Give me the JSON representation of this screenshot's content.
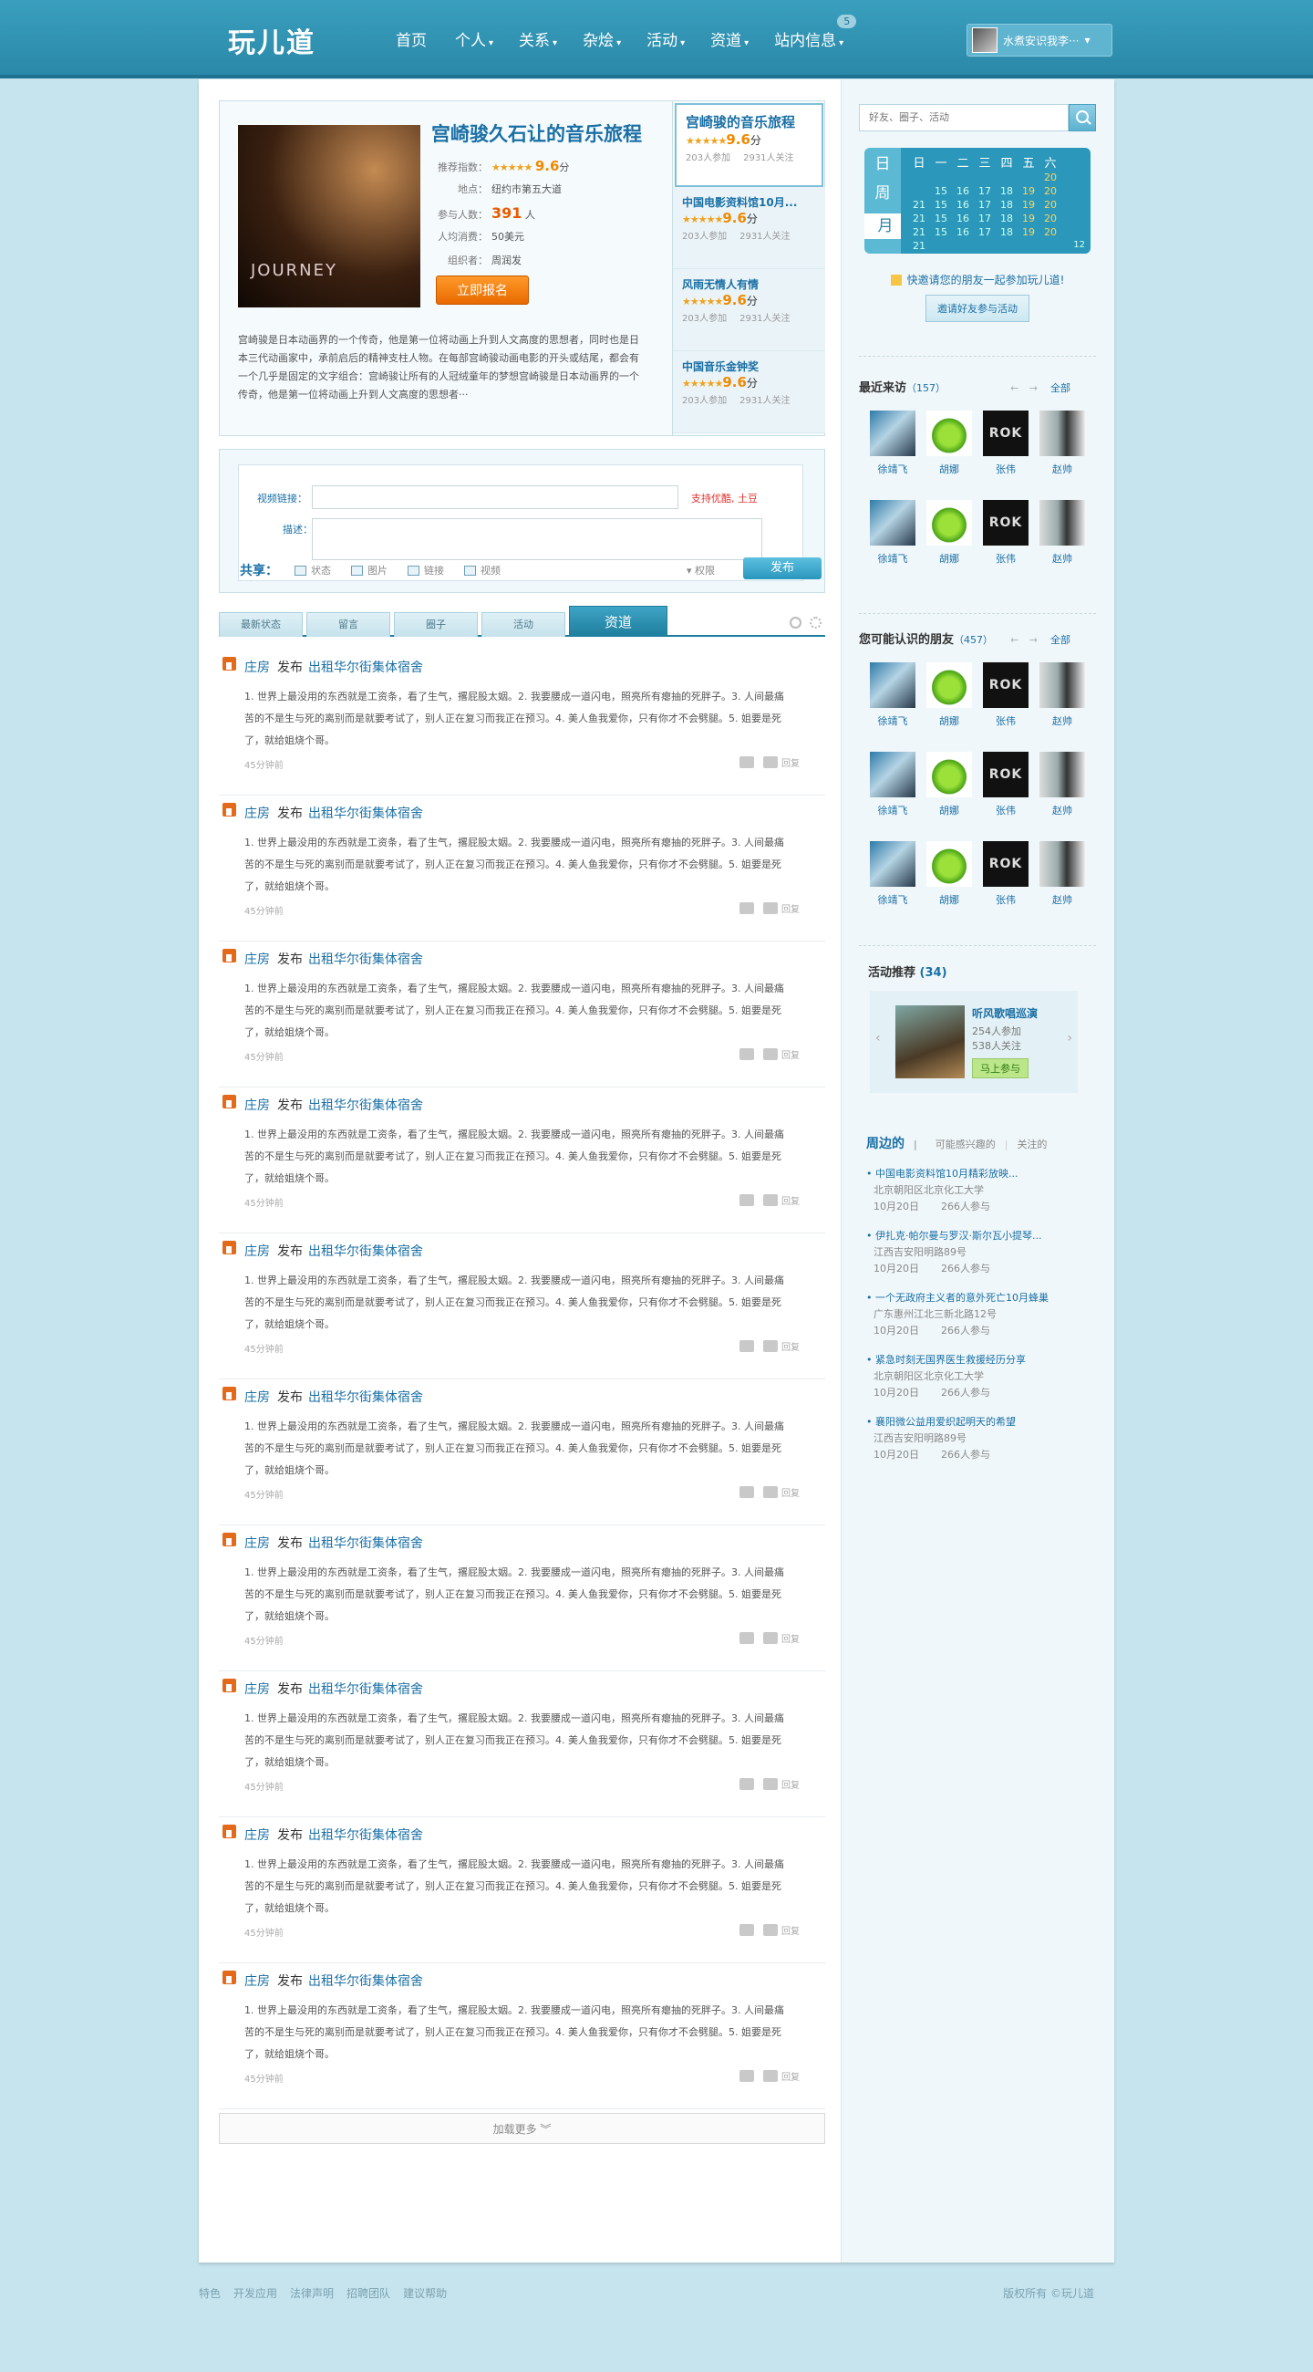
{
  "header": {
    "logo": "玩儿道",
    "nav": [
      {
        "label": "首页",
        "caret": ""
      },
      {
        "label": "个人",
        "caret": "▾"
      },
      {
        "label": "关系",
        "caret": "▾"
      },
      {
        "label": "杂烩",
        "caret": "▾"
      },
      {
        "label": "活动",
        "caret": "▾"
      },
      {
        "label": "资道",
        "caret": "▾"
      },
      {
        "label": "站内信息",
        "caret": "▾"
      }
    ],
    "message_badge": "5",
    "user_name": "水煮安识我李···",
    "user_caret": "▾"
  },
  "featured": {
    "title": "宫崎骏久石让的音乐旅程",
    "poster_text": "JOURNEY",
    "rows": [
      {
        "k": "推荐指数：",
        "stars": "★★★★★",
        "score": "9.6",
        "unit": "分"
      },
      {
        "k": "地点：",
        "v": "纽约市第五大道"
      },
      {
        "k": "参与人数：",
        "count": "391",
        "unit": "人"
      },
      {
        "k": "人均消费：",
        "v": "50美元"
      },
      {
        "k": "组织者：",
        "v": "周润发"
      }
    ],
    "signup": "立即报名",
    "desc": "宫崎骏是日本动画界的一个传奇，他是第一位将动画上升到人文高度的思想者，同时也是日本三代动画家中，承前启后的精神支柱人物。在每部宫崎骏动画电影的开头或结尾，都会有一个几乎是固定的文字组合：宫崎骏让所有的人冠绒童年的梦想宫崎骏是日本动画界的一个传奇，他是第一位将动画上升到人文高度的思想者···",
    "list": [
      {
        "title": "宫崎骏的音乐旅程",
        "stars": "★★★★★",
        "score": "9.6",
        "unit": "分",
        "join": "203人参加",
        "follow": "2931人关注"
      },
      {
        "title": "中国电影资料馆10月...",
        "stars": "★★★★★",
        "score": "9.6",
        "unit": "分",
        "join": "203人参加",
        "follow": "2931人关注"
      },
      {
        "title": "风雨无情人有情",
        "stars": "★★★★★",
        "score": "9.6",
        "unit": "分",
        "join": "203人参加",
        "follow": "2931人关注"
      },
      {
        "title": "中国音乐金钟奖",
        "stars": "★★★★★",
        "score": "9.6",
        "unit": "分",
        "join": "203人参加",
        "follow": "2931人关注"
      }
    ]
  },
  "share": {
    "video_label": "视频链接：",
    "desc_label": "描述：",
    "hint": "支持优酷, 土豆",
    "share_label": "共享：",
    "tools": [
      "状态",
      "图片",
      "链接",
      "视频"
    ],
    "permission": "▾ 权限",
    "post": "发布"
  },
  "tabs": [
    "最新状态",
    "留言",
    "圈子",
    "活动",
    "资道"
  ],
  "feed": {
    "user": "庄房",
    "verb": "发布",
    "topic": "出租华尔街集体宿舍",
    "text": "1. 世界上最没用的东西就是工资条，看了生气，撂屁股太姻。2. 我要腰成一道闪电，照亮所有瘪抽的死胖子。3. 人间最痛苦的不是生与死的离别而是就要考试了，别人正在复习而我正在预习。4. 美人鱼我爱你，只有你才不会劈腿。5. 姐要是死了，就给姐烧个哥。",
    "time": "45分钟前",
    "act": "回复",
    "count": 10
  },
  "load_more": "加载更多 ︾",
  "search": {
    "placeholder": "好友、圈子、活动"
  },
  "calendar": {
    "side": [
      "日",
      "周",
      "月"
    ],
    "head": [
      "日",
      "一",
      "二",
      "三",
      "四",
      "五",
      "六"
    ],
    "weeks": [
      [
        "",
        "",
        "",
        "",
        "",
        "",
        "20"
      ],
      [
        "",
        "15",
        "16",
        "17",
        "18",
        "19",
        "20"
      ],
      [
        "21",
        "15",
        "16",
        "17",
        "18",
        "19",
        "20"
      ],
      [
        "21",
        "15",
        "16",
        "17",
        "18",
        "19",
        "20"
      ],
      [
        "21",
        "15",
        "16",
        "17",
        "18",
        "19",
        "20"
      ],
      [
        "21",
        "",
        "",
        "",
        "",
        "",
        ""
      ]
    ],
    "page": "12"
  },
  "invite": {
    "text": "快邀请您的朋友一起参加玩儿道!",
    "button": "邀请好友参与活动"
  },
  "recent": {
    "title": "最近来访",
    "count": "（157）",
    "all": "全部",
    "arrows": "← →"
  },
  "maybe": {
    "title": "您可能认识的朋友",
    "count": "（457）",
    "all": "全部",
    "arrows": "← →"
  },
  "friends": [
    {
      "name": "徐靖飞",
      "ph": "p1"
    },
    {
      "name": "胡娜",
      "ph": "p2"
    },
    {
      "name": "张伟",
      "ph": "p3"
    },
    {
      "name": "赵帅",
      "ph": "p4"
    }
  ],
  "rok_text": "ROK",
  "recommend": {
    "title": "活动推荐",
    "count": "(34)",
    "item_title": "听风歌唱巡演",
    "join": "254人参加",
    "follow": "538人关注",
    "btn": "马上参与"
  },
  "nearby": {
    "tabs": [
      "周边的",
      "可能感兴趣的",
      "关注的"
    ],
    "items": [
      {
        "title": "• 中国电影资料馆10月精彩放映...",
        "loc": "北京朝阳区北京化工大学",
        "date": "10月20日",
        "n": "266人参与"
      },
      {
        "title": "• 伊扎克·帕尔曼与罗汉·斯尔瓦小提琴...",
        "loc": "江西吉安阳明路89号",
        "date": "10月20日",
        "n": "266人参与"
      },
      {
        "title": "• 一个无政府主义者的意外死亡10月蜂巢",
        "loc": "广东惠州江北三新北路12号",
        "date": "10月20日",
        "n": "266人参与"
      },
      {
        "title": "• 紧急时刻无国界医生救援经历分享",
        "loc": "北京朝阳区北京化工大学",
        "date": "10月20日",
        "n": "266人参与"
      },
      {
        "title": "• 襄阳微公益用爱织起明天的希望",
        "loc": "江西吉安阳明路89号",
        "date": "10月20日",
        "n": "266人参与"
      }
    ]
  },
  "footer": {
    "links": [
      "特色",
      "开发应用",
      "法律声明",
      "招聘团队",
      "建议帮助"
    ],
    "copy": "版权所有 ©玩儿道"
  }
}
